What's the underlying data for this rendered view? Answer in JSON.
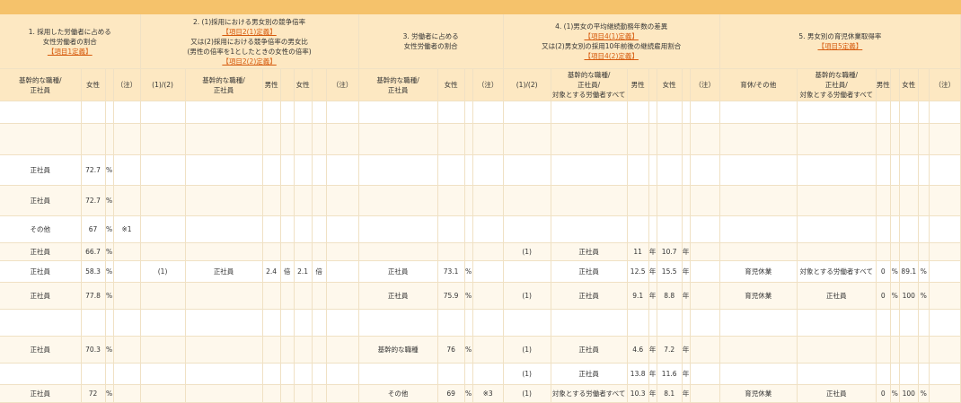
{
  "groups": [
    {
      "title_lines": [
        "1. 採用した労働者に占める",
        "女性労働者の割合"
      ],
      "def": "【項目1定義】"
    },
    {
      "title_lines": [
        "2. (1)採用における男女別の競争倍率"
      ],
      "def": "【項目2(1)定義】",
      "title_lines2": [
        "又は(2)採用における競争倍率の男女比",
        "(男性の倍率を1としたときの女性の倍率)"
      ],
      "def2": "【項目2(2)定義】"
    },
    {
      "title_lines": [
        "3. 労働者に占める",
        "女性労働者の割合"
      ]
    },
    {
      "title_lines": [
        "4. (1)男女の平均継続勤務年数の差異"
      ],
      "def": "【項目4(1)定義】",
      "title_lines2": [
        "又は(2)男女別の採用10年前後の継続雇用割合"
      ],
      "def2": "【項目4(2)定義】"
    },
    {
      "title_lines": [
        "5. 男女別の育児休業取得率"
      ],
      "def": "【項目5定義】"
    }
  ],
  "subheaders": [
    [
      "基幹的な職種/",
      "正社員"
    ],
    [
      "女性"
    ],
    [
      ""
    ],
    [
      "（注）"
    ],
    [
      "(1)/(2)"
    ],
    [
      "基幹的な職種/",
      "正社員"
    ],
    [
      "男性"
    ],
    [
      ""
    ],
    [
      "女性"
    ],
    [
      ""
    ],
    [
      "（注）"
    ],
    [
      "基幹的な職種/",
      "正社員"
    ],
    [
      "女性"
    ],
    [
      ""
    ],
    [
      "（注）"
    ],
    [
      "(1)/(2)"
    ],
    [
      "基幹的な職種/",
      "正社員/",
      "対象とする労働者すべて"
    ],
    [
      "男性"
    ],
    [
      ""
    ],
    [
      "女性"
    ],
    [
      ""
    ],
    [
      "（注）"
    ],
    [
      "育休/その他"
    ],
    [
      "基幹的な職種/",
      "正社員/",
      "対象とする労働者すべて"
    ],
    [
      "男性"
    ],
    [
      ""
    ],
    [
      "女性"
    ],
    [
      ""
    ],
    [
      "（注）"
    ]
  ],
  "rows": [
    [
      "",
      "",
      "",
      "",
      "",
      "",
      "",
      "",
      "",
      "",
      "",
      "",
      "",
      "",
      "",
      "",
      "",
      "",
      "",
      "",
      "",
      "",
      "",
      "",
      "",
      "",
      "",
      "",
      ""
    ],
    [
      "",
      "",
      "",
      "",
      "",
      "",
      "",
      "",
      "",
      "",
      "",
      "",
      "",
      "",
      "",
      "",
      "",
      "",
      "",
      "",
      "",
      "",
      "",
      "",
      "",
      "",
      "",
      "",
      ""
    ],
    [
      "正社員",
      "72.7",
      "%",
      "",
      "",
      "",
      "",
      "",
      "",
      "",
      "",
      "",
      "",
      "",
      "",
      "",
      "",
      "",
      "",
      "",
      "",
      "",
      "",
      "",
      "",
      "",
      "",
      "",
      ""
    ],
    [
      "正社員",
      "72.7",
      "%",
      "",
      "",
      "",
      "",
      "",
      "",
      "",
      "",
      "",
      "",
      "",
      "",
      "",
      "",
      "",
      "",
      "",
      "",
      "",
      "",
      "",
      "",
      "",
      "",
      "",
      ""
    ],
    [
      "その他",
      "67",
      "%",
      "※1",
      "",
      "",
      "",
      "",
      "",
      "",
      "",
      "",
      "",
      "",
      "",
      "",
      "",
      "",
      "",
      "",
      "",
      "",
      "",
      "",
      "",
      "",
      "",
      "",
      ""
    ],
    [
      "正社員",
      "66.7",
      "%",
      "",
      "",
      "",
      "",
      "",
      "",
      "",
      "",
      "",
      "",
      "",
      "",
      "(1)",
      "正社員",
      "11",
      "年",
      "10.7",
      "年",
      "",
      "",
      "",
      "",
      "",
      "",
      "",
      ""
    ],
    [
      "正社員",
      "58.3",
      "%",
      "",
      "(1)",
      "正社員",
      "2.4",
      "倍",
      "2.1",
      "倍",
      "",
      "正社員",
      "73.1",
      "%",
      "",
      "",
      "正社員",
      "12.5",
      "年",
      "15.5",
      "年",
      "",
      "育児休業",
      "対象とする労働者すべて",
      "0",
      "%",
      "89.1",
      "%",
      ""
    ],
    [
      "正社員",
      "77.8",
      "%",
      "",
      "",
      "",
      "",
      "",
      "",
      "",
      "",
      "正社員",
      "75.9",
      "%",
      "",
      "(1)",
      "正社員",
      "9.1",
      "年",
      "8.8",
      "年",
      "",
      "育児休業",
      "正社員",
      "0",
      "%",
      "100",
      "%",
      ""
    ],
    [
      "",
      "",
      "",
      "",
      "",
      "",
      "",
      "",
      "",
      "",
      "",
      "",
      "",
      "",
      "",
      "",
      "",
      "",
      "",
      "",
      "",
      "",
      "",
      "",
      "",
      "",
      "",
      "",
      ""
    ],
    [
      "正社員",
      "70.3",
      "%",
      "",
      "",
      "",
      "",
      "",
      "",
      "",
      "",
      "基幹的な職種",
      "76",
      "%",
      "",
      "(1)",
      "正社員",
      "4.6",
      "年",
      "7.2",
      "年",
      "",
      "",
      "",
      "",
      "",
      "",
      "",
      ""
    ],
    [
      "",
      "",
      "",
      "",
      "",
      "",
      "",
      "",
      "",
      "",
      "",
      "",
      "",
      "",
      "",
      "(1)",
      "正社員",
      "13.8",
      "年",
      "11.6",
      "年",
      "",
      "",
      "",
      "",
      "",
      "",
      "",
      ""
    ],
    [
      "正社員",
      "72",
      "%",
      "",
      "",
      "",
      "",
      "",
      "",
      "",
      "",
      "その他",
      "69",
      "%",
      "※3",
      "(1)",
      "対象とする労働者すべて",
      "10.3",
      "年",
      "8.1",
      "年",
      "",
      "育児休業",
      "正社員",
      "0",
      "%",
      "100",
      "%",
      ""
    ]
  ]
}
